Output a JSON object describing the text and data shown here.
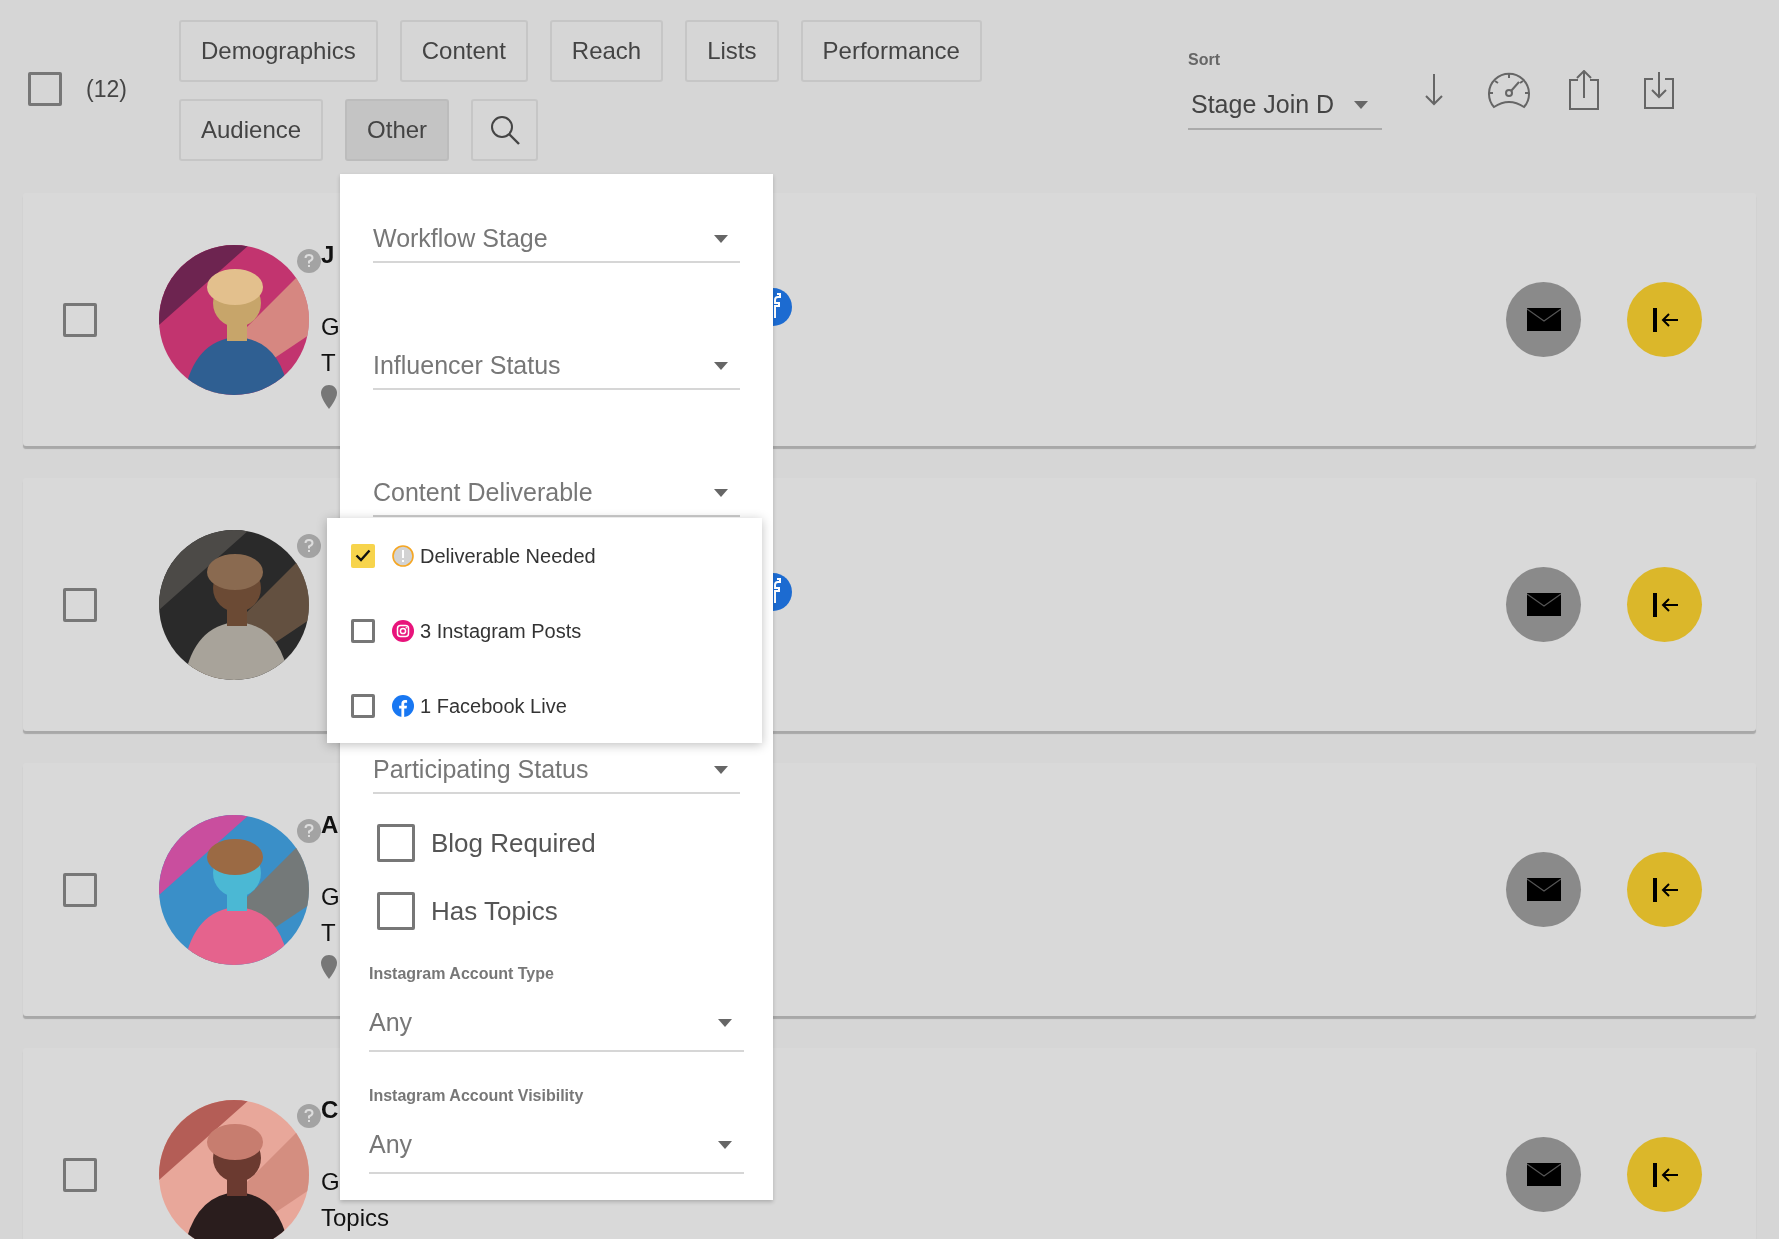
{
  "selection": {
    "checked": false,
    "count": "(12)"
  },
  "filters": [
    {
      "label": "Demographics",
      "selected": false
    },
    {
      "label": "Content",
      "selected": false
    },
    {
      "label": "Reach",
      "selected": false
    },
    {
      "label": "Lists",
      "selected": false
    },
    {
      "label": "Performance",
      "selected": false
    },
    {
      "label": "Audience",
      "selected": false
    },
    {
      "label": "Other",
      "selected": true
    }
  ],
  "sort": {
    "label": "Sort",
    "value": "Stage Join D"
  },
  "cards": [
    {
      "checked": false,
      "name": "J",
      "line_3": "G",
      "line_4": "T",
      "pin": true,
      "platform_badge": true
    },
    {
      "checked": false,
      "platform_badge": true
    },
    {
      "checked": false,
      "name": "A",
      "line_3": "G",
      "line_4": "T",
      "pin": true,
      "platform_badge": false
    },
    {
      "checked": false,
      "name": "C",
      "line_3": "G",
      "line_4": "Topics",
      "platform_badge": false
    }
  ],
  "filter_panel": {
    "fields": [
      {
        "kind": "select",
        "placeholder": "Workflow Stage",
        "expanded": false
      },
      {
        "kind": "select",
        "placeholder": "Influencer Status",
        "expanded": false
      },
      {
        "kind": "select",
        "placeholder": "Content Deliverable",
        "expanded": true,
        "options": [
          {
            "kind": "alert",
            "label": "Deliverable Needed",
            "checked": true
          },
          {
            "kind": "instagram",
            "label": "3 Instagram Posts",
            "checked": false
          },
          {
            "kind": "facebook",
            "label": "1 Facebook Live",
            "checked": false
          }
        ]
      },
      {
        "kind": "select",
        "placeholder": "Participating Status",
        "expanded": false
      },
      {
        "kind": "checkbox",
        "label": "Blog Required",
        "checked": false
      },
      {
        "kind": "checkbox",
        "label": "Has Topics",
        "checked": false
      },
      {
        "kind": "labeled_select",
        "label": "Instagram Account Type",
        "value": "Any"
      },
      {
        "kind": "labeled_select",
        "label": "Instagram Account Visibility",
        "value": "Any"
      }
    ]
  }
}
